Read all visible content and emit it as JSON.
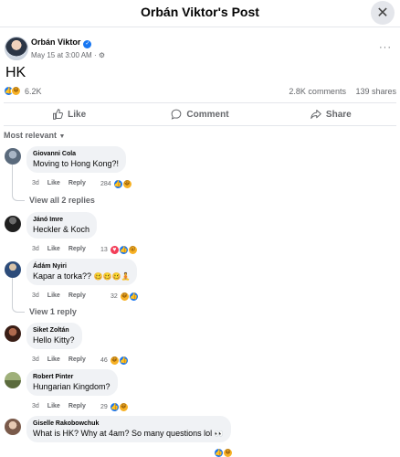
{
  "header": {
    "title": "Orbán Viktor's Post",
    "close": "✕"
  },
  "post": {
    "author": "Orbán Viktor",
    "timestamp": "May 15 at 3:00 AM",
    "privacy_icon": "gear-icon",
    "more": "···",
    "text": "HK",
    "reaction_count": "6.2K",
    "comments_count": "2.8K comments",
    "shares_count": "139 shares"
  },
  "actions": {
    "like": "Like",
    "comment": "Comment",
    "share": "Share"
  },
  "sort": {
    "label": "Most relevant"
  },
  "comments": [
    {
      "name": "Giovanni Cola",
      "text": "Moving to Hong Kong?!",
      "time": "3d",
      "like": "Like",
      "reply": "Reply",
      "reactions": "284",
      "view_replies": "View all 2 replies"
    },
    {
      "name": "Jánó Imre",
      "text": "Heckler & Koch",
      "time": "3d",
      "like": "Like",
      "reply": "Reply",
      "reactions": "13"
    },
    {
      "name": "Ádám Nyiri",
      "text": "Kapar a torka??",
      "time": "3d",
      "like": "Like",
      "reply": "Reply",
      "reactions": "32",
      "view_replies": "View 1 reply"
    },
    {
      "name": "Siket Zoltán",
      "text": "Hello Kitty?",
      "time": "3d",
      "like": "Like",
      "reply": "Reply",
      "reactions": "46"
    },
    {
      "name": "Robert Pinter",
      "text": "Hungarian Kingdom?",
      "time": "3d",
      "like": "Like",
      "reply": "Reply",
      "reactions": "29"
    },
    {
      "name": "Giselle Rakobowchuk",
      "text": "What is HK? Why at 4am? So many questions lol",
      "time": "3d",
      "like": "Like",
      "reply": "Reply",
      "reactions": ""
    }
  ],
  "colors": {
    "accent": "#1877f2",
    "muted": "#65676b",
    "bubble": "#f0f2f5"
  }
}
